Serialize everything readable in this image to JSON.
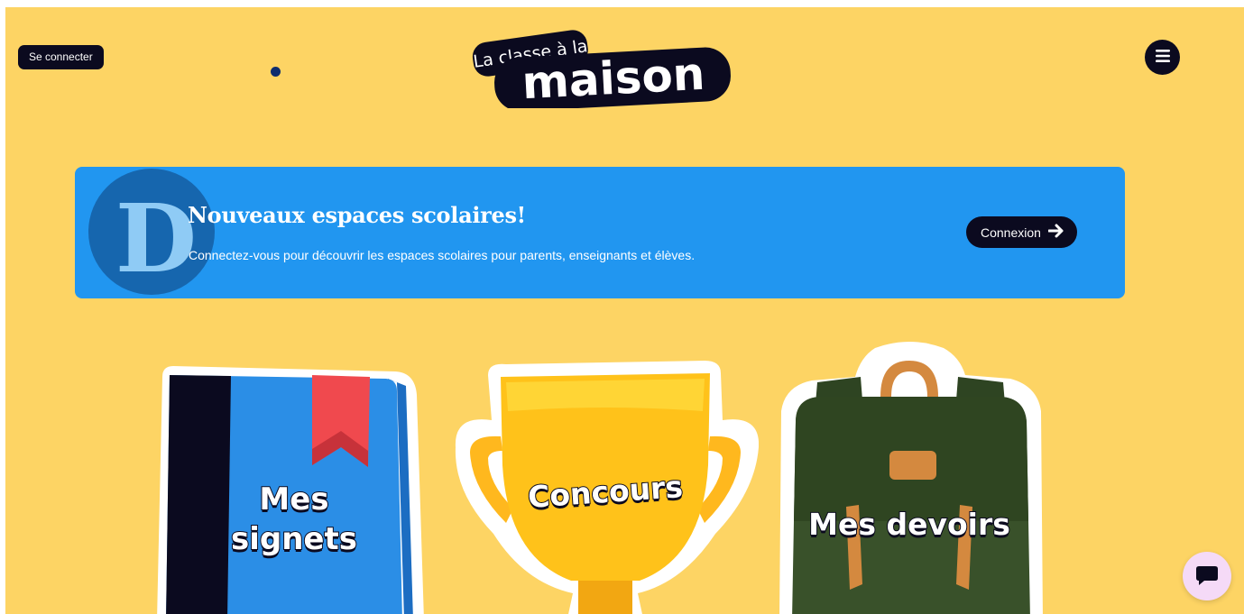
{
  "header": {
    "login_label": "Se connecter",
    "logo": {
      "line1": "La classe à la",
      "line2": "maison"
    },
    "menu_icon": "hamburger-icon"
  },
  "banner": {
    "badge_letter": "D",
    "title": "Nouveaux espaces scolaires!",
    "text": "Connectez-vous pour découvrir les espaces scolaires pour parents, enseignants et élèves.",
    "button_label": "Connexion",
    "button_icon": "arrow-right-icon"
  },
  "cards": [
    {
      "label_line1": "Mes",
      "label_line2": "signets",
      "icon": "book-icon"
    },
    {
      "label": "Concours",
      "icon": "trophy-icon"
    },
    {
      "label": "Mes devoirs",
      "icon": "backpack-icon"
    }
  ],
  "chat": {
    "icon": "chat-bubble-icon"
  },
  "colors": {
    "background": "#FDD464",
    "banner": "#2196F0",
    "dark": "#0B0A1F",
    "book": "#2B8EE6",
    "bookmark": "#F0494E",
    "trophy": "#FFC21A",
    "backpack": "#39512A",
    "chat": "#F5DAF7"
  }
}
